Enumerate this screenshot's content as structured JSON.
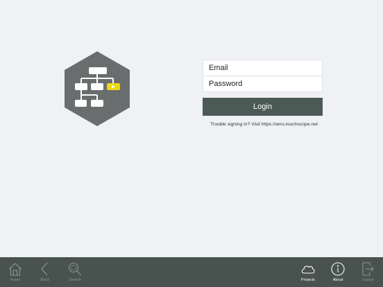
{
  "login": {
    "email_placeholder": "Email",
    "password_placeholder": "Password",
    "login_label": "Login",
    "trouble_text": "Trouble signing in? Visit https://ams.touchscope.net"
  },
  "tabbar": {
    "home": "Home",
    "back": "Back",
    "search": "Search",
    "projects": "Projects",
    "about": "About",
    "logout": "Logout"
  },
  "colors": {
    "background": "#eff1f4",
    "button": "#4c5a56",
    "tabbar": "#48524f",
    "logo_hex": "#686d6d",
    "logo_accent": "#e9d80f"
  },
  "icons": [
    "app-logo",
    "home-icon",
    "back-icon",
    "search-icon",
    "cloud-icon",
    "info-icon",
    "logout-icon"
  ]
}
